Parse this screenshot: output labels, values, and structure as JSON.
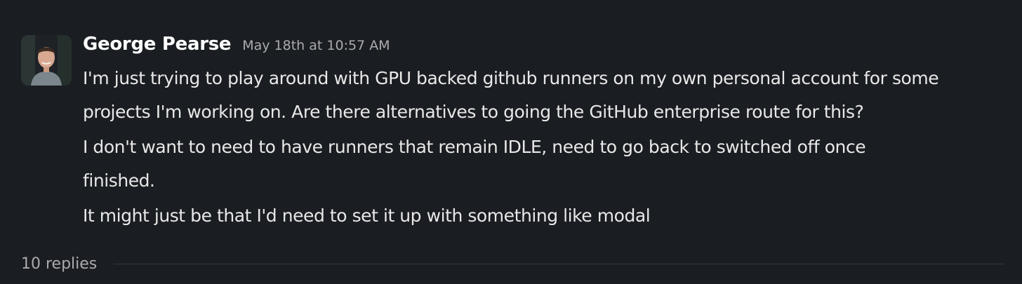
{
  "message": {
    "sender": "George Pearse",
    "timestamp": "May 18th at 10:57 AM",
    "avatar_icon": "user-photo-avatar",
    "paragraphs": [
      {
        "line1": "I'm just trying to play around with GPU backed github runners on my own personal account for some",
        "line2": "projects I'm working on. Are there alternatives to going the GitHub enterprise route for this?"
      },
      {
        "line1": "I don't want to need to have runners that remain IDLE, need to go back to switched off once",
        "line2": "finished."
      },
      {
        "line1": "It might just be that I'd need to set it up with something like modal"
      }
    ]
  },
  "thread": {
    "replies_label": "10 replies"
  },
  "colors": {
    "background": "#1a1d21",
    "sender": "#ffffff",
    "text": "#e8e8e8",
    "muted": "#ababad"
  }
}
